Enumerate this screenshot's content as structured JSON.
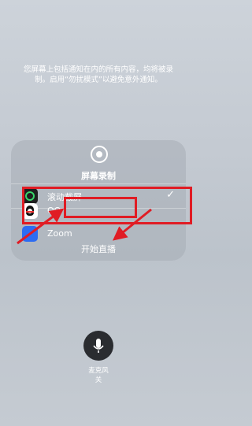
{
  "notice": "您屏幕上包括通知在内的所有内容，均将被录制。启用“勿扰模式”以避免意外通知。",
  "panel": {
    "title": "屏幕录制",
    "apps": [
      {
        "label": "滚动截屏",
        "selected": true,
        "icon": "scroll-capture-icon"
      },
      {
        "label": "QQ",
        "selected": false,
        "icon": "qq-penguin-icon"
      },
      {
        "label": "Zoom",
        "selected": false,
        "icon": "zoom-icon"
      }
    ],
    "check_mark": "✓",
    "start_label": "开始直播"
  },
  "mic": {
    "label": "麦克风",
    "state": "关"
  },
  "colors": {
    "highlight": "#e01c24",
    "accent_green": "#37d66a"
  }
}
